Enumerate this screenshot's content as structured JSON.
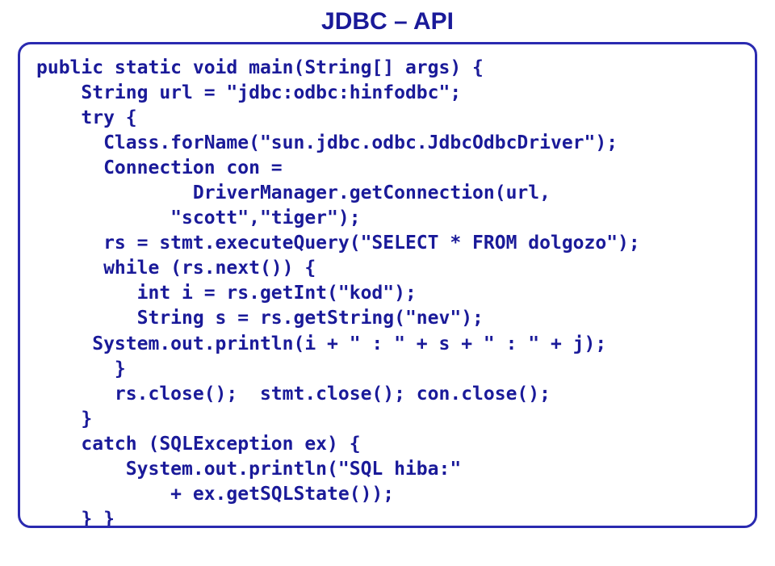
{
  "title": "JDBC – API",
  "code": "public static void main(String[] args) {\n    String url = \"jdbc:odbc:hinfodbc\";\n    try {\n      Class.forName(\"sun.jdbc.odbc.JdbcOdbcDriver\");\n      Connection con =\n              DriverManager.getConnection(url,\n            \"scott\",\"tiger\");\n      rs = stmt.executeQuery(\"SELECT * FROM dolgozo\");\n      while (rs.next()) {\n         int i = rs.getInt(\"kod\");\n         String s = rs.getString(\"nev\");\n     System.out.println(i + \" : \" + s + \" : \" + j);\n       }\n       rs.close();  stmt.close(); con.close();\n    }\n    catch (SQLException ex) {\n        System.out.println(\"SQL hiba:\"\n            + ex.getSQLState());\n    } }"
}
